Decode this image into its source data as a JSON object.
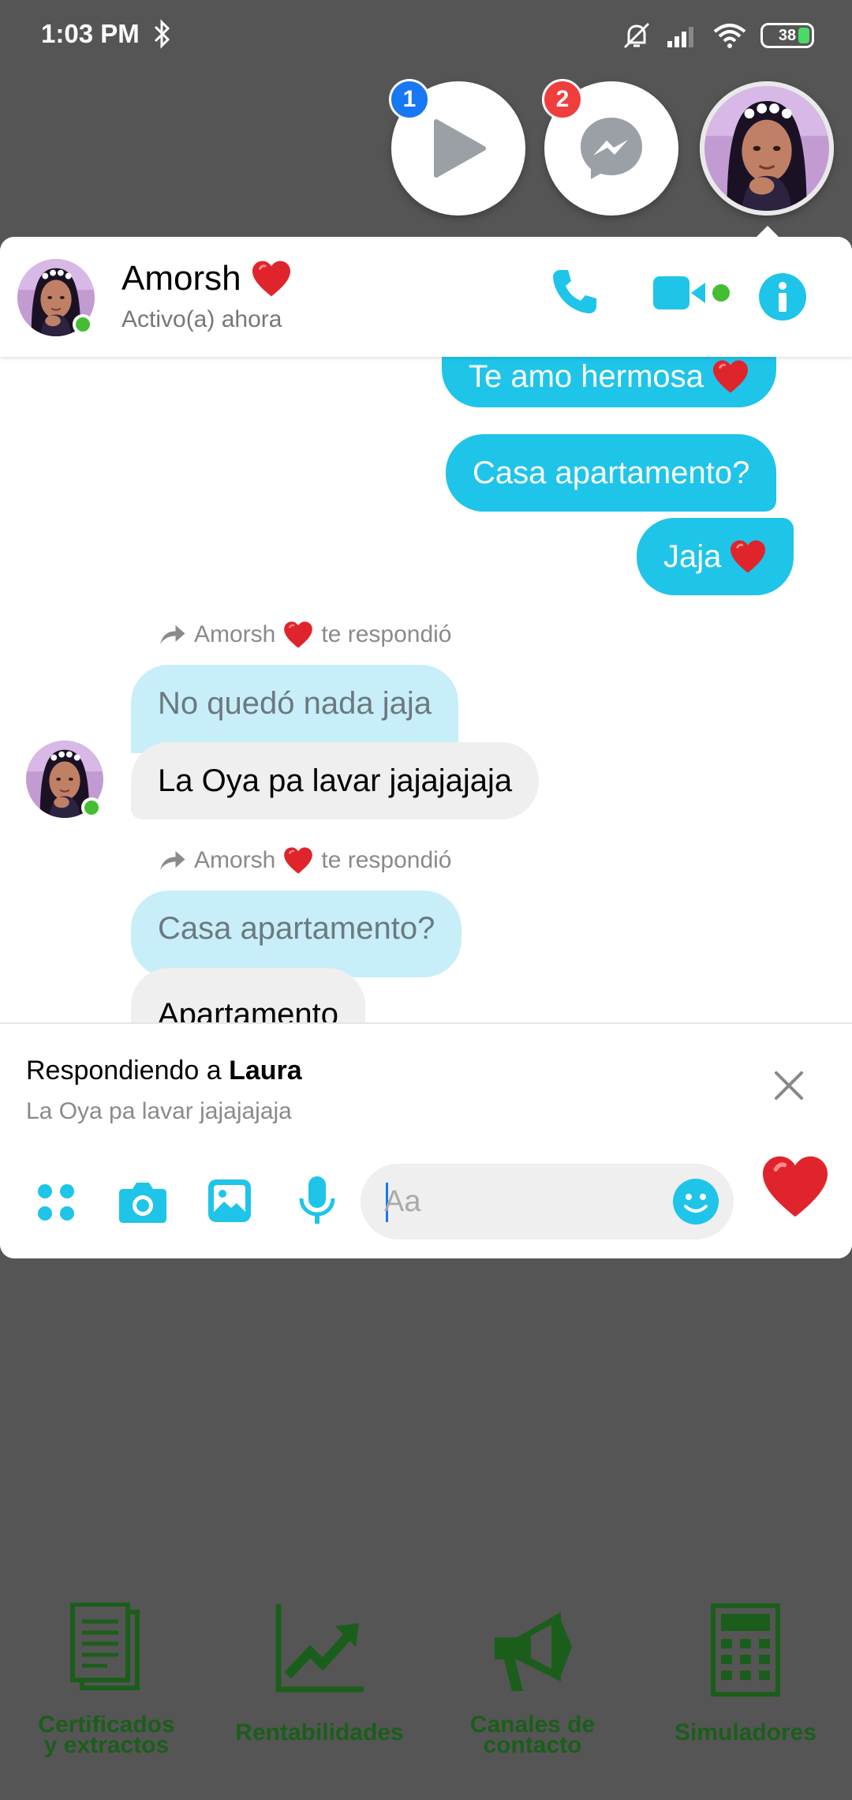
{
  "status_bar": {
    "time": "1:03 PM",
    "battery": "38"
  },
  "chat_heads": [
    {
      "name": "play-chat-head",
      "badge": "1"
    },
    {
      "name": "messenger-chat-head",
      "badge": "2"
    },
    {
      "name": "contact-chat-head"
    }
  ],
  "chat": {
    "contact_name": "Amorsh",
    "contact_status": "Activo(a) ahora"
  },
  "messages": {
    "out_1": "Te amo hermosa",
    "out_2": "Casa apartamento?",
    "out_3": "Jaja",
    "reply_1": {
      "label_name": "Amorsh",
      "label_text": "te respondió",
      "quoted": "No quedó nada jaja",
      "text": "La Oya pa lavar jajajajaja"
    },
    "reply_2": {
      "label_name": "Amorsh",
      "label_text": "te respondió",
      "quoted": "Casa apartamento?",
      "text": "Apartamento"
    }
  },
  "reply_bar": {
    "prefix": "Respondiendo a",
    "name": "Laura",
    "quoted_text": "La Oya pa lavar jajajajaja"
  },
  "composer": {
    "placeholder": "Aa"
  },
  "bottom_nav": [
    {
      "line1": "Certificados",
      "line2": "y extractos"
    },
    {
      "line1": "Rentabilidades",
      "line2": ""
    },
    {
      "line1": "Canales de",
      "line2": "contacto"
    },
    {
      "line1": "Simuladores",
      "line2": ""
    }
  ],
  "colors": {
    "accent": "#1fc4e9",
    "nav_green": "#1b5e1b",
    "heart": "#e0242b",
    "online": "#44bd32"
  }
}
